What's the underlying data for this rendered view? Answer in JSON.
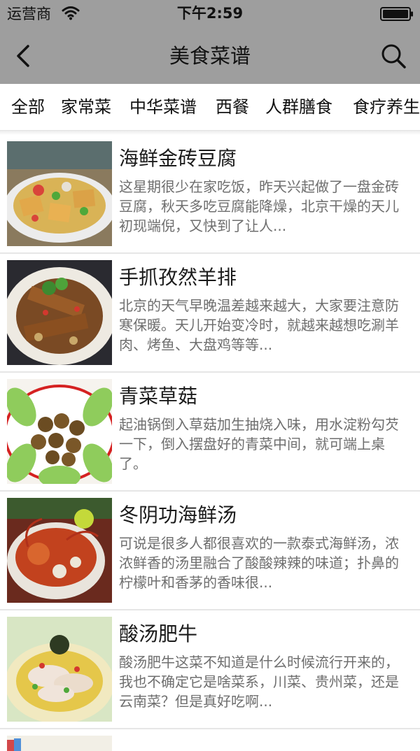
{
  "status_bar": {
    "carrier": "运营商",
    "time": "下午2:59",
    "wifi_icon": "wifi-icon",
    "battery_icon": "battery-icon"
  },
  "nav": {
    "title": "美食菜谱",
    "back_icon": "chevron-left-icon",
    "search_icon": "search-icon"
  },
  "tabs": [
    "全部",
    "家常菜",
    "中华菜谱",
    "西餐",
    "人群膳食",
    "食疗养生"
  ],
  "recipes": [
    {
      "title": "海鲜金砖豆腐",
      "description": "这星期很少在家吃饭，昨天兴起做了一盘金砖豆腐，秋天多吃豆腐能降燥，北京干燥的天儿初现端倪，又快到了让人..."
    },
    {
      "title": "手抓孜然羊排",
      "description": "北京的天气早晚温差越来越大，大家要注意防寒保暖。天儿开始变冷时，就越来越想吃涮羊肉、烤鱼、大盘鸡等等..."
    },
    {
      "title": "青菜草菇",
      "description": "起油锅倒入草菇加生抽烧入味，用水淀粉勾芡一下，倒入摆盘好的青菜中间，就可端上桌了。"
    },
    {
      "title": "冬阴功海鲜汤",
      "description": "可说是很多人都很喜欢的一款泰式海鲜汤，浓浓鲜香的汤里融合了酸酸辣辣的味道；扑鼻的柠檬叶和香茅的香味很..."
    },
    {
      "title": "酸汤肥牛",
      "description": "酸汤肥牛这菜不知道是什么时候流行开来的，我也不确定它是啥菜系，川菜、贵州菜，还是云南菜？但是真好吃啊..."
    }
  ],
  "colors": {
    "nav_bg": "#9e9e9e",
    "title_text": "#1b1b1b",
    "desc_text": "#6e6e6e",
    "separator": "#e6e6e6"
  }
}
